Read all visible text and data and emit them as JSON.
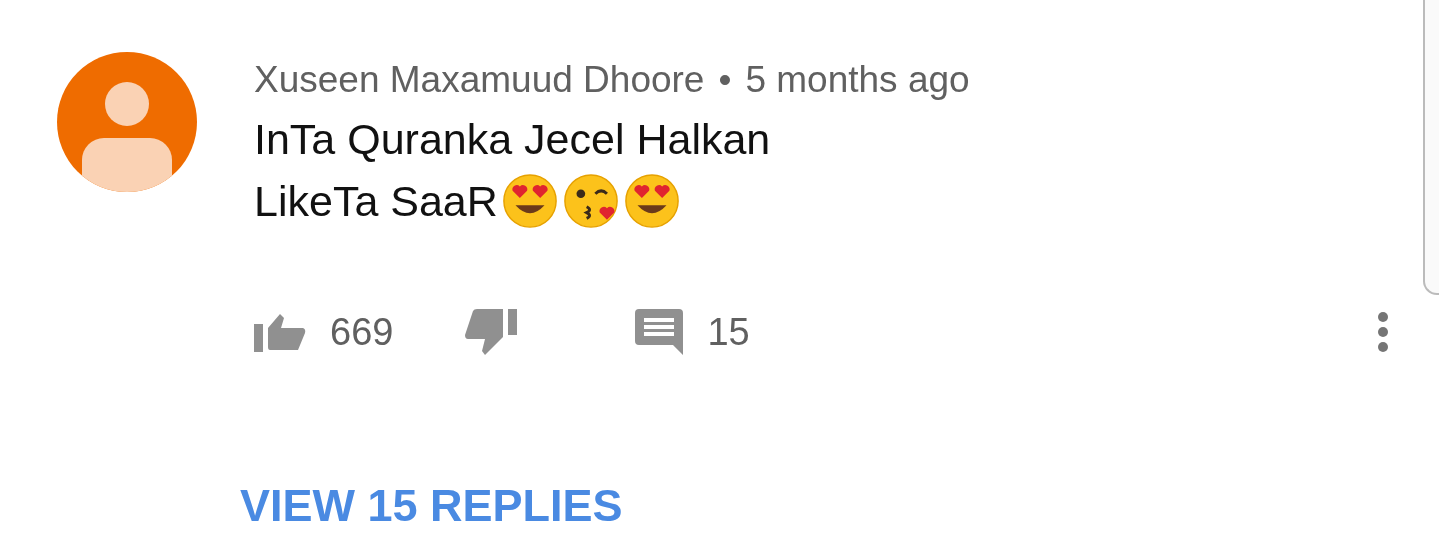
{
  "comment": {
    "author": "Xuseen Maxamuud Dhoore",
    "separator": "•",
    "time": "5 months ago",
    "lines": [
      "InTa Quranka Jecel Halkan",
      "LikeTa SaaR"
    ],
    "emojis": [
      {
        "kind": "heart-eyes"
      },
      {
        "kind": "kiss"
      },
      {
        "kind": "heart-eyes"
      }
    ],
    "likes": "669",
    "replies_count": "15"
  },
  "view_replies": "VIEW 15 REPLIES"
}
